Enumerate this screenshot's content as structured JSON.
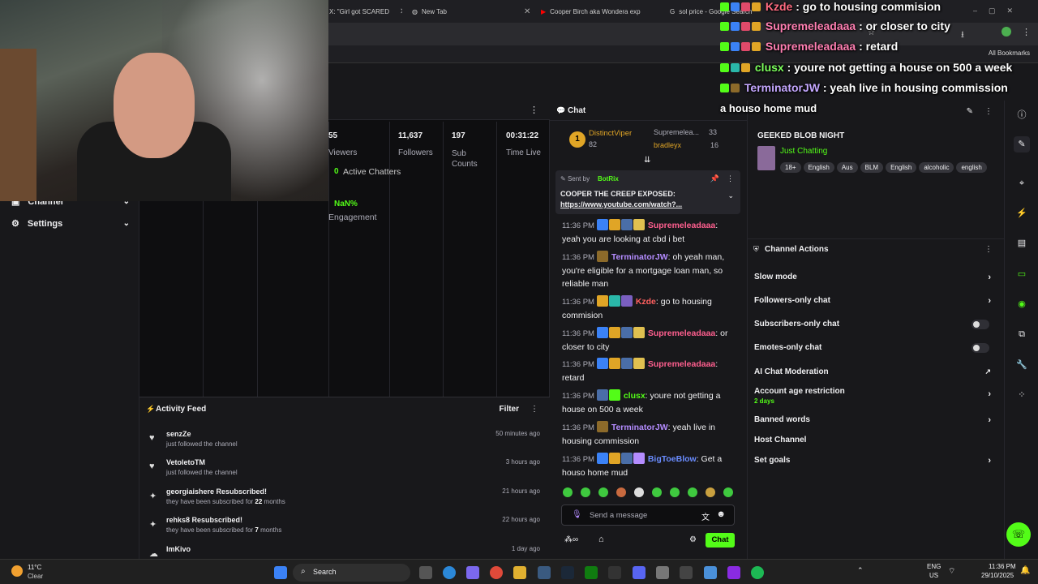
{
  "tabs": [
    {
      "label": "X: \"Girl got SCARED"
    },
    {
      "label": "New Tab"
    },
    {
      "label": "Cooper Birch aka Wondera exp"
    },
    {
      "label": "sol price - Google Search"
    }
  ],
  "bookmarks": {
    "all_label": "All Bookmarks"
  },
  "overlay_chat": [
    {
      "user": "Kzde",
      "text": " : go to housing commision",
      "color": "#ff6b81"
    },
    {
      "user": "Supremeleadaaa",
      "text": " : or closer to city",
      "color": "#ff7fb2"
    },
    {
      "user": "Supremeleadaaa",
      "text": " : retard",
      "color": "#ff7fb2"
    },
    {
      "user": "clusx",
      "text": " : youre not getting a house on 500 a week",
      "color": "#7cff5c"
    },
    {
      "user": "TerminatorJW",
      "text": " : yeah live in housing commission",
      "color": "#c4a7ff"
    },
    {
      "user": "",
      "text": "a houso home mud",
      "color": "#ffffff"
    }
  ],
  "sidebar": {
    "channel_label": "Channel",
    "settings_label": "Settings"
  },
  "stats": {
    "viewers_value": "55",
    "viewers_label": "Viewers",
    "followers_value": "11,637",
    "followers_label": "Followers",
    "subs_value": "197",
    "subs_label": "Sub Counts",
    "time_value": "00:31:22",
    "time_label": "Time Live",
    "active_value": "0",
    "active_label": "Active Chatters",
    "engagement_value": "NaN%",
    "engagement_label": "Engagement"
  },
  "activity": {
    "title": "Activity Feed",
    "filter_label": "Filter",
    "items": [
      {
        "name": "senzZe",
        "sub": "just followed the channel",
        "time": "50 minutes ago"
      },
      {
        "name": "VetoletoTM",
        "sub": "just followed the channel",
        "time": "3 hours ago"
      },
      {
        "name": "georgiaishere Resubscribed!",
        "sub_pre": "they have been subscribed for ",
        "sub_num": "22",
        "sub_post": " months",
        "time": "21 hours ago"
      },
      {
        "name": "rehks8 Resubscribed!",
        "sub_pre": "they have been subscribed for ",
        "sub_num": "7",
        "sub_post": " months",
        "time": "22 hours ago"
      },
      {
        "name": "ImKivo",
        "sub": "",
        "time": "1 day ago"
      }
    ]
  },
  "chat": {
    "title": "Chat",
    "leaderboard": [
      {
        "rank": "1",
        "name": "DistinctViper",
        "points": "82"
      },
      {
        "name": "Supremelea...",
        "points": "33"
      },
      {
        "name": "bradleyx",
        "points": "16"
      }
    ],
    "pinned": {
      "sent_by_prefix": "Sent by",
      "bot": "BotRix",
      "title": "COOPER THE CREEP EXPOSED:",
      "link": "https://www.youtube.com/watch?..."
    },
    "messages": [
      {
        "time": "11:36 PM",
        "user": "Supremeleadaaa",
        "color": "#ff5f8f",
        "text": "yeah you are looking at cbd i bet"
      },
      {
        "time": "11:36 PM",
        "user": "TerminatorJW",
        "color": "#b48cff",
        "text": "oh yeah man, you're eligible for a mortgage loan man, so reliable man"
      },
      {
        "time": "11:36 PM",
        "user": "Kzde",
        "color": "#ff5f5f",
        "text": "go to housing commision"
      },
      {
        "time": "11:36 PM",
        "user": "Supremeleadaaa",
        "color": "#ff5f8f",
        "text": "or closer to city"
      },
      {
        "time": "11:36 PM",
        "user": "Supremeleadaaa",
        "color": "#ff5f8f",
        "text": "retard"
      },
      {
        "time": "11:36 PM",
        "user": "clusx",
        "color": "#53fc18",
        "text": "youre not getting a house on 500 a week"
      },
      {
        "time": "11:36 PM",
        "user": "TerminatorJW",
        "color": "#b48cff",
        "text": "yeah live in housing commission"
      },
      {
        "time": "11:36 PM",
        "user": "BigToeBlow",
        "color": "#6a8cff",
        "text": "Get a houso home mud"
      }
    ],
    "input_placeholder": "Send a message",
    "send_label": "Chat"
  },
  "stream_info": {
    "title": "GEEKED BLOB NIGHT",
    "category": "Just Chatting",
    "tags": [
      "18+",
      "English",
      "Aus",
      "BLM",
      "English",
      "alcoholic",
      "english"
    ]
  },
  "channel_actions": {
    "title": "Channel Actions",
    "items": [
      {
        "label": "Slow mode",
        "kind": "chevron"
      },
      {
        "label": "Followers-only chat",
        "kind": "chevron"
      },
      {
        "label": "Subscribers-only chat",
        "kind": "toggle"
      },
      {
        "label": "Emotes-only chat",
        "kind": "toggle"
      },
      {
        "label": "AI Chat Moderation",
        "kind": "external"
      },
      {
        "label": "Account age restriction",
        "sub": "2 days",
        "kind": "chevron"
      },
      {
        "label": "Banned words",
        "kind": "chevron"
      },
      {
        "label": "Host Channel",
        "kind": "none"
      },
      {
        "label": "Set goals",
        "kind": "chevron"
      }
    ]
  },
  "taskbar": {
    "weather_temp": "11°C",
    "weather_desc": "Clear",
    "search_label": "Search",
    "lang": "ENG",
    "region": "US",
    "time": "11:36 PM",
    "date": "29/10/2025"
  },
  "colors": {
    "accent": "#53fc18",
    "background": "#0e0e10",
    "panel": "#18181b"
  }
}
